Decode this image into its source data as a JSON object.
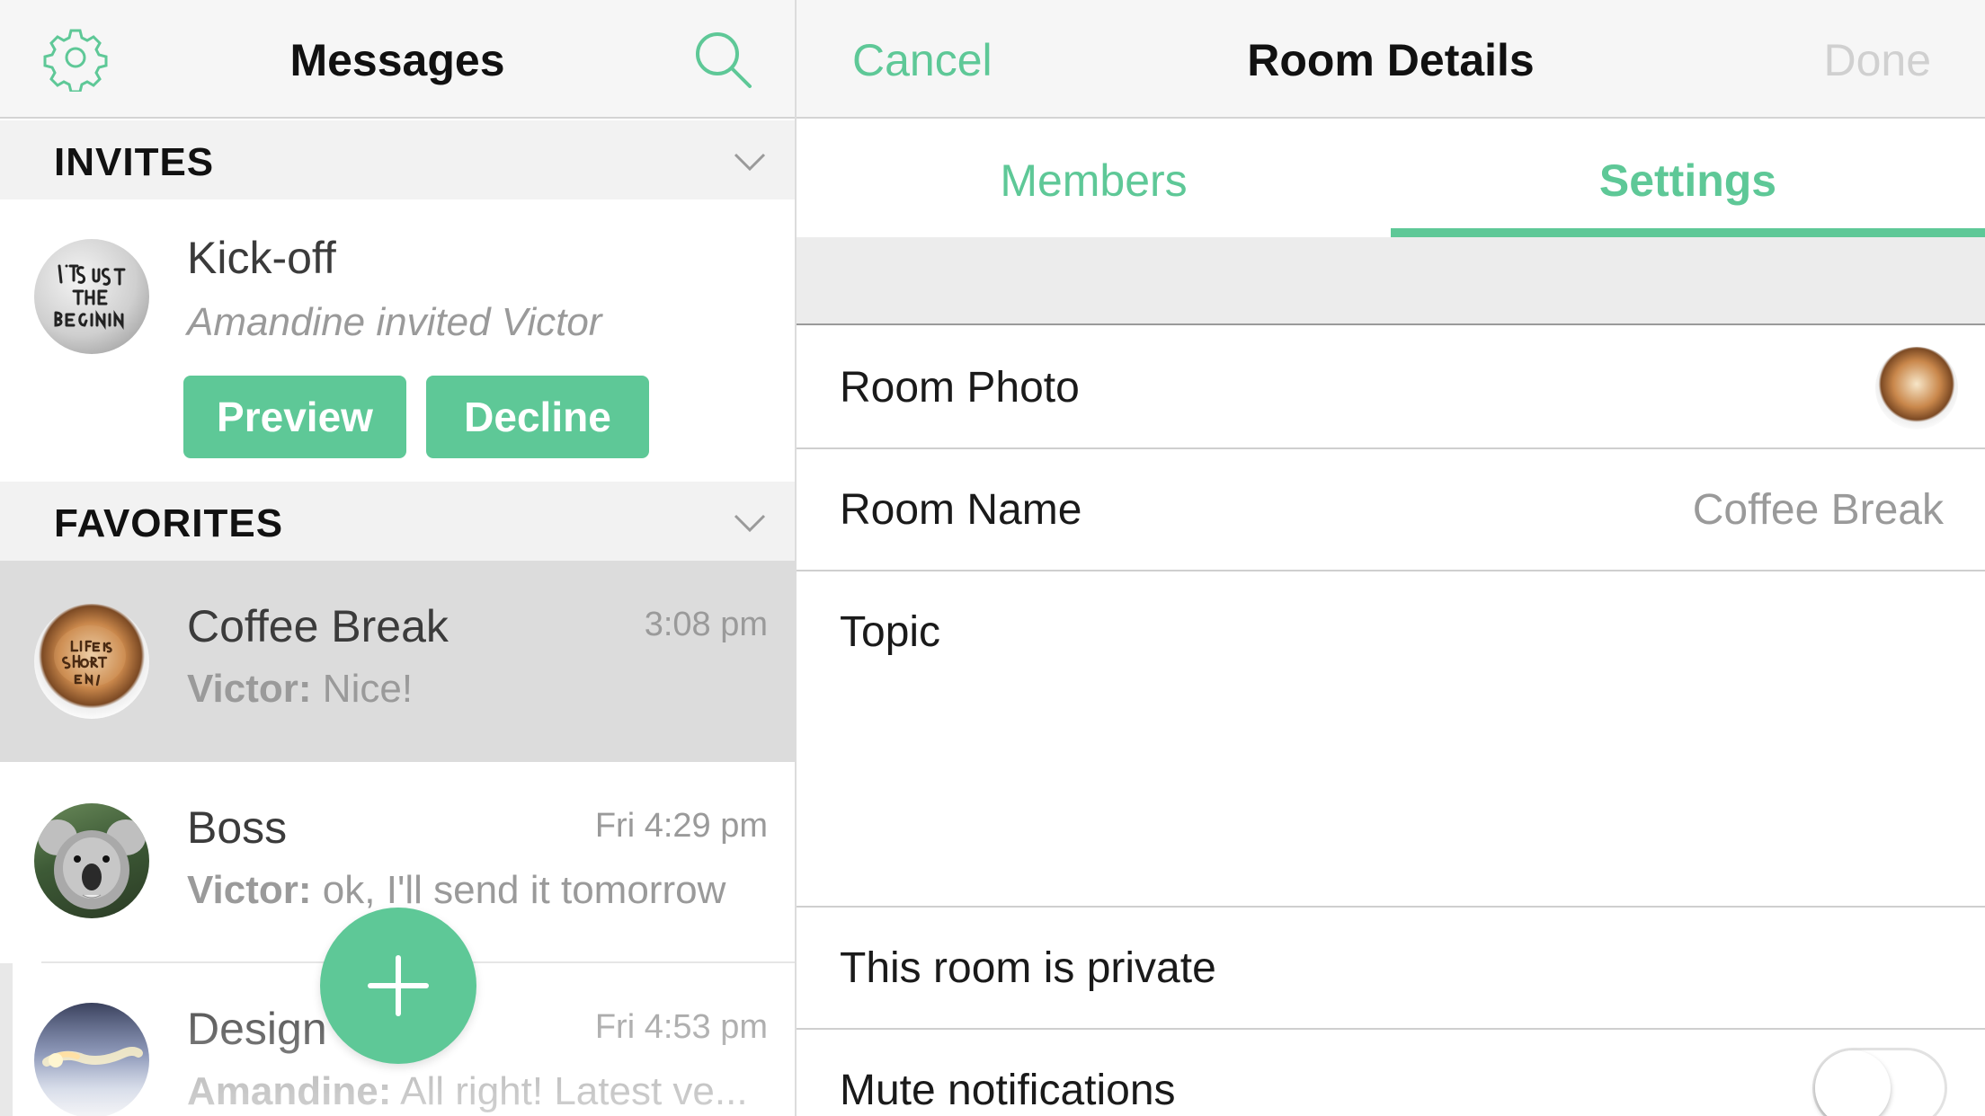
{
  "left_panel": {
    "title": "Messages",
    "icons": {
      "settings": "gear-icon",
      "search": "search-icon",
      "chevron": "chevron-down-icon",
      "add": "plus-icon"
    },
    "sections": {
      "invites_label": "INVITES",
      "favorites_label": "FAVORITES"
    },
    "invite": {
      "name": "Kick-off",
      "subtitle": "Amandine invited Victor",
      "avatar_text": "IT'S JUST THE BEGINNING",
      "preview_label": "Preview",
      "decline_label": "Decline"
    },
    "rooms": [
      {
        "name": "Coffee Break",
        "time": "3:08 pm",
        "sender": "Victor:",
        "message": "Nice!",
        "selected": true,
        "avatar_text": "Life is SHORT Enjoy coffee"
      },
      {
        "name": "Boss",
        "time": "Fri 4:29 pm",
        "sender": "Victor:",
        "message": "ok, I'll send it tomorrow",
        "selected": false
      },
      {
        "name": "Design",
        "time": "Fri 4:53 pm",
        "sender": "Amandine:",
        "message": "All right! Latest ve...",
        "selected": false
      }
    ]
  },
  "right_panel": {
    "cancel_label": "Cancel",
    "title": "Room Details",
    "done_label": "Done",
    "tabs": [
      "Members",
      "Settings"
    ],
    "active_tab": "Settings",
    "cells": {
      "room_photo_label": "Room Photo",
      "room_name_label": "Room Name",
      "room_name_value": "Coffee Break",
      "topic_label": "Topic",
      "private_label": "This room is private",
      "mute_label": "Mute notifications",
      "mute_enabled": false
    }
  },
  "colors": {
    "accent": "#5ec897",
    "selected_row": "#dcdcdc",
    "section_bg": "#f2f2f2",
    "secondary_text": "#9a9a9a"
  }
}
